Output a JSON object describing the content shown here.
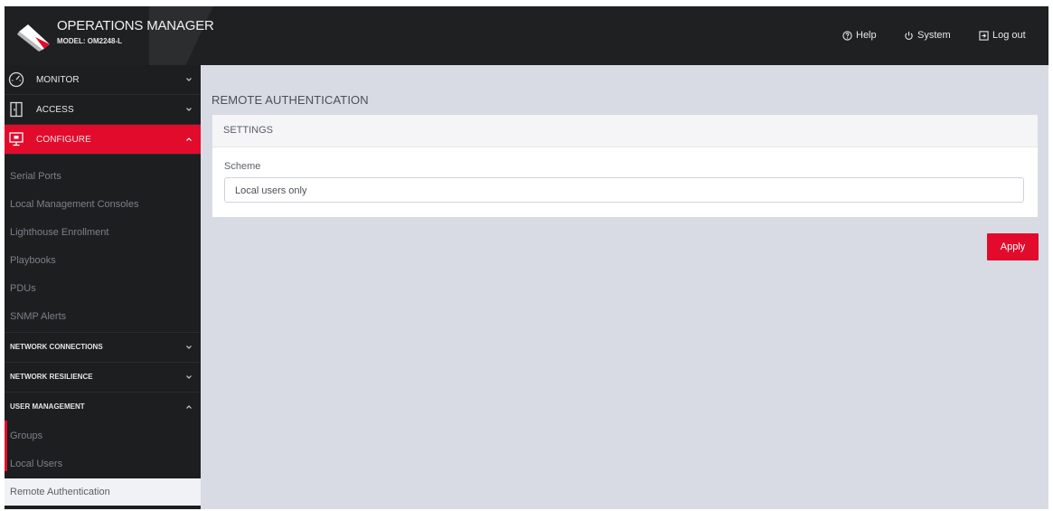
{
  "header": {
    "title": "OPERATIONS MANAGER",
    "model": "MODEL: OM2248-L",
    "help_label": "Help",
    "system_label": "System",
    "logout_label": "Log out"
  },
  "sidebar": {
    "top_items": [
      {
        "label": "MONITOR",
        "icon": "speedometer-icon"
      },
      {
        "label": "ACCESS",
        "icon": "door-icon"
      },
      {
        "label": "CONFIGURE",
        "icon": "monitor-icon"
      }
    ],
    "configure_items": [
      "Serial Ports",
      "Local Management Consoles",
      "Lighthouse Enrollment",
      "Playbooks",
      "PDUs",
      "SNMP Alerts"
    ],
    "sections": [
      {
        "label": "NETWORK CONNECTIONS",
        "expanded": false
      },
      {
        "label": "NETWORK RESILIENCE",
        "expanded": false
      },
      {
        "label": "USER MANAGEMENT",
        "expanded": true
      }
    ],
    "user_management_items": [
      "Groups",
      "Local Users",
      "Remote Authentication"
    ],
    "active_item": "Remote Authentication"
  },
  "main": {
    "page_title": "REMOTE AUTHENTICATION",
    "card_title": "SETTINGS",
    "scheme_label": "Scheme",
    "scheme_value": "Local users only",
    "apply_label": "Apply"
  },
  "colors": {
    "accent": "#e30b2c",
    "header_bg": "#1f2022",
    "sidebar_bg": "#1d1e20",
    "content_bg": "#d9dbe4"
  }
}
